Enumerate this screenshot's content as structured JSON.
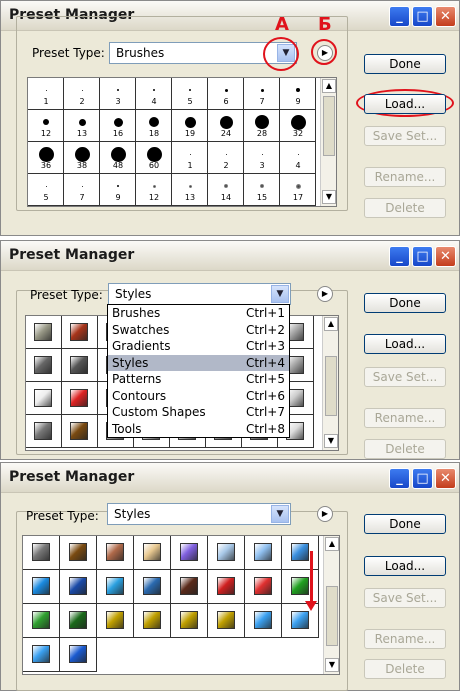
{
  "title": "Preset Manager",
  "preset_type_label": "Preset Type:",
  "buttons": {
    "done": "Done",
    "load": "Load...",
    "save": "Save Set...",
    "rename": "Rename...",
    "delete": "Delete"
  },
  "win1": {
    "select": "Brushes",
    "annot_a": "А",
    "annot_b": "Б",
    "rows": [
      [
        "1",
        "2",
        "3",
        "4",
        "5",
        "6",
        "7",
        "9"
      ],
      [
        "12",
        "13",
        "16",
        "18",
        "19",
        "24",
        "28",
        "32"
      ],
      [
        "36",
        "38",
        "48",
        "60",
        "1",
        "2",
        "3",
        "4"
      ],
      [
        "5",
        "7",
        "9",
        "12",
        "13",
        "14",
        "15",
        "17"
      ]
    ]
  },
  "win2": {
    "select": "Styles",
    "menu": [
      {
        "label": "Brushes",
        "key": "Ctrl+1"
      },
      {
        "label": "Swatches",
        "key": "Ctrl+2"
      },
      {
        "label": "Gradients",
        "key": "Ctrl+3"
      },
      {
        "label": "Styles",
        "key": "Ctrl+4"
      },
      {
        "label": "Patterns",
        "key": "Ctrl+5"
      },
      {
        "label": "Contours",
        "key": "Ctrl+6"
      },
      {
        "label": "Custom Shapes",
        "key": "Ctrl+7"
      },
      {
        "label": "Tools",
        "key": "Ctrl+8"
      }
    ]
  },
  "win3": {
    "select": "Styles"
  },
  "colors": {
    "annotation": "#e0131c",
    "highlight": "#b1b8c8"
  }
}
